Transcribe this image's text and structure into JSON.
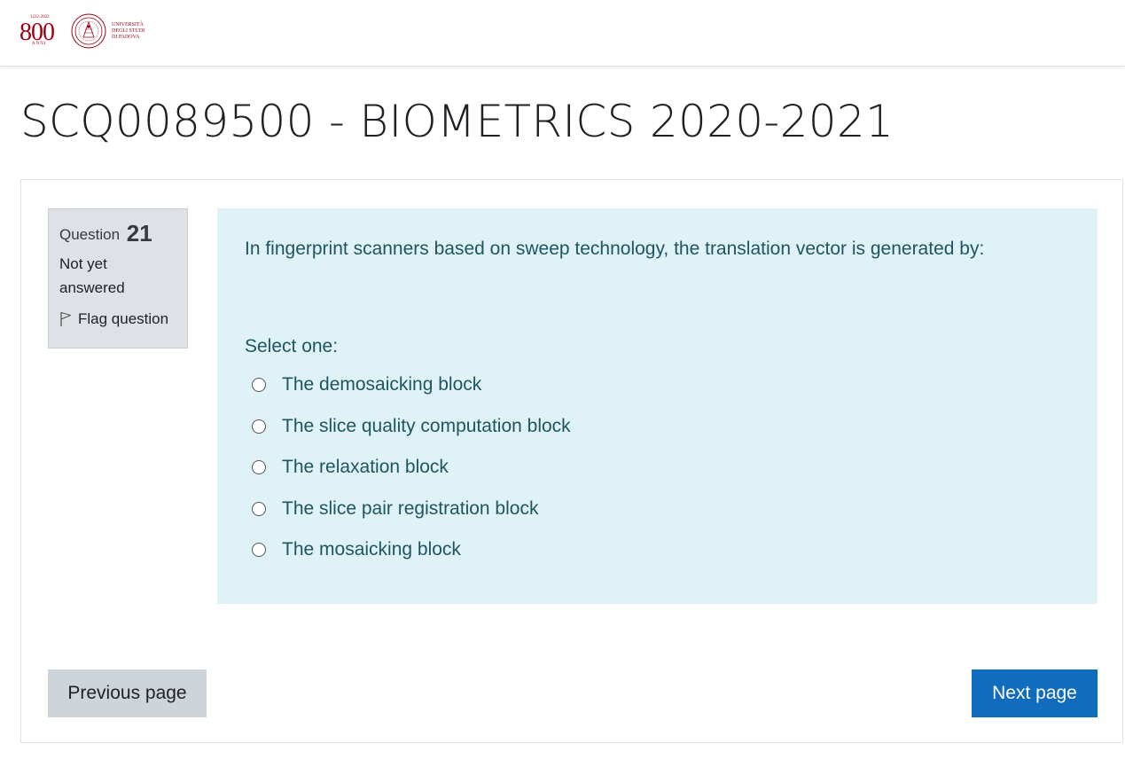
{
  "header": {
    "logo": {
      "anniversary_number": "800",
      "anniversary_years": "1222-2022",
      "anniversary_word": "ANNI",
      "university_lines": [
        "UNIVERSITÀ",
        "DEGLI STUDI",
        "DI PADOVA"
      ]
    }
  },
  "page": {
    "title": "SCQ0089500 - BIOMETRICS 2020-2021"
  },
  "question_info": {
    "label": "Question",
    "number": "21",
    "state": "Not yet answered",
    "flag_label": "Flag question",
    "flag_icon": "flag-outline-icon"
  },
  "question": {
    "text": "In fingerprint scanners based on sweep technology, the translation vector is generated by:",
    "prompt": "Select one:",
    "options": [
      {
        "label": "The demosaicking block",
        "selected": false
      },
      {
        "label": "The slice quality computation block",
        "selected": false
      },
      {
        "label": "The relaxation block",
        "selected": false
      },
      {
        "label": "The slice pair registration block",
        "selected": false
      },
      {
        "label": "The mosaicking block",
        "selected": false
      }
    ]
  },
  "navigation": {
    "previous_label": "Previous page",
    "next_label": "Next page"
  },
  "colors": {
    "brand_red": "#9b0014",
    "info_background": "#def2f8",
    "info_text": "#1f5561",
    "primary_button": "#0f6cbf",
    "secondary_button": "#ced4da",
    "question_info_background": "#dee2e6"
  }
}
